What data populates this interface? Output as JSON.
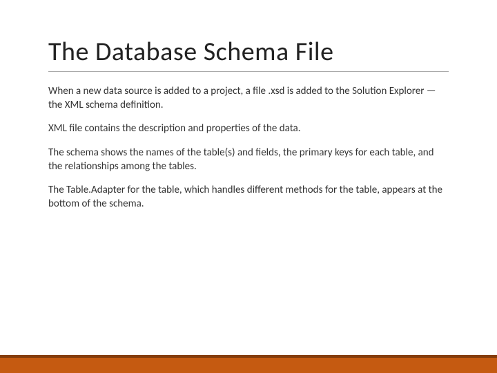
{
  "slide": {
    "title": "The Database Schema File",
    "paragraphs": [
      "When a new data source is added to a project, a file .xsd is added to the Solution Explorer — the XML schema definition.",
      "XML file contains the description and properties of the data.",
      "The schema shows the names of the table(s) and fields, the primary keys for each table, and the relationships among the tables.",
      "The Table.Adapter for the table, which handles different methods for the table, appears at the bottom of the schema."
    ]
  },
  "colors": {
    "accent_bar": "#c55a11",
    "accent_bar_top": "#843c0c"
  }
}
